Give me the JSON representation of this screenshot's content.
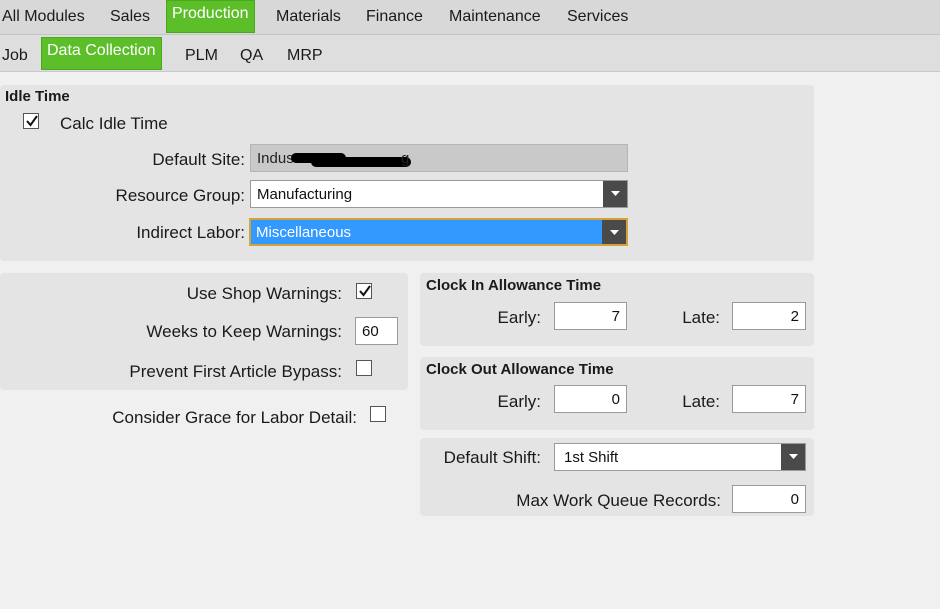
{
  "top_tabs": [
    "All Modules",
    "Sales",
    "Production",
    "Materials",
    "Finance",
    "Maintenance",
    "Services"
  ],
  "sub_tabs": [
    "Job",
    "Data Collection",
    "PLM",
    "QA",
    "MRP"
  ],
  "idle": {
    "title": "Idle Time",
    "calc_label": "Calc Idle Time",
    "calc_checked": true,
    "default_site_label": "Default Site:",
    "default_site_value": "Indust",
    "default_site_suffix": "g",
    "resource_group_label": "Resource Group:",
    "resource_group_value": "Manufacturing",
    "indirect_labor_label": "Indirect Labor:",
    "indirect_labor_value": "Miscellaneous"
  },
  "warnings": {
    "use_shop_label": "Use Shop Warnings:",
    "use_shop_checked": true,
    "weeks_label": "Weeks to Keep Warnings:",
    "weeks_value": "60",
    "prevent_label": "Prevent First Article Bypass:",
    "prevent_checked": false,
    "grace_label": "Consider Grace for Labor Detail:",
    "grace_checked": false
  },
  "clock_in": {
    "title": "Clock In Allowance Time",
    "early_label": "Early:",
    "early_value": "7",
    "late_label": "Late:",
    "late_value": "2"
  },
  "clock_out": {
    "title": "Clock Out Allowance Time",
    "early_label": "Early:",
    "early_value": "0",
    "late_label": "Late:",
    "late_value": "7"
  },
  "shift": {
    "label": "Default Shift:",
    "value": "1st Shift"
  },
  "max_queue": {
    "label": "Max Work Queue Records:",
    "value": "0"
  },
  "colors": {
    "accent": "#5cbf2a",
    "selection": "#3399ff"
  },
  "icons": {
    "checkmark": "checkmark-icon",
    "dropdown": "chevron-down-icon"
  }
}
